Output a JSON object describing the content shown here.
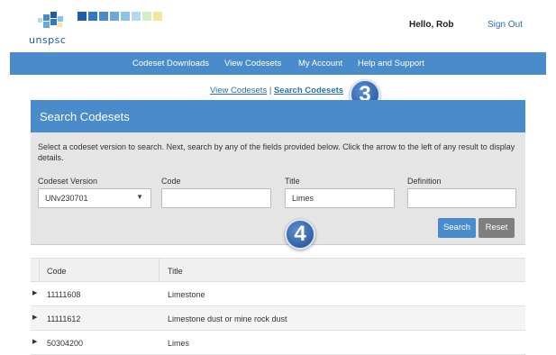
{
  "header": {
    "logo_text": "unspsc",
    "greeting": "Hello, Rob",
    "signout": "Sign Out",
    "logo_colors": [
      "#1d5ea8",
      "#2e78c4",
      "#4a8ccb",
      "#6aa8da",
      "#8cc2e6",
      "#b4daf0",
      "#d8ecc2",
      "#f2e79a"
    ]
  },
  "nav": {
    "items": [
      "Codeset Downloads",
      "View Codesets",
      "My Account",
      "Help and Support"
    ]
  },
  "sublinks": {
    "view": "View Codesets",
    "separator": "|",
    "search": "Search Codesets"
  },
  "callouts": [
    "3",
    "4"
  ],
  "search_panel": {
    "title": "Search Codesets",
    "intro": "Select a codeset version to search. Next, search by any of the fields provided below. Click the arrow to the left of any result to display details.",
    "fields": {
      "version_label": "Codeset Version",
      "version_value": "UNv230701",
      "code_label": "Code",
      "code_value": "",
      "title_label": "Title",
      "title_value": "Limes",
      "definition_label": "Definition",
      "definition_value": ""
    },
    "search_button": "Search",
    "reset_button": "Reset"
  },
  "results": {
    "headers": {
      "code": "Code",
      "title": "Title"
    },
    "rows": [
      {
        "code": "11111608",
        "title": "Limestone"
      },
      {
        "code": "11111612",
        "title": "Limestone dust or mine rock dust"
      },
      {
        "code": "50304200",
        "title": "Limes"
      }
    ]
  },
  "colors": {
    "accent": "#4a8ccb",
    "reset": "#7f7f7f",
    "panel_bg": "#e5e5e5",
    "link": "#2a6fb8"
  }
}
